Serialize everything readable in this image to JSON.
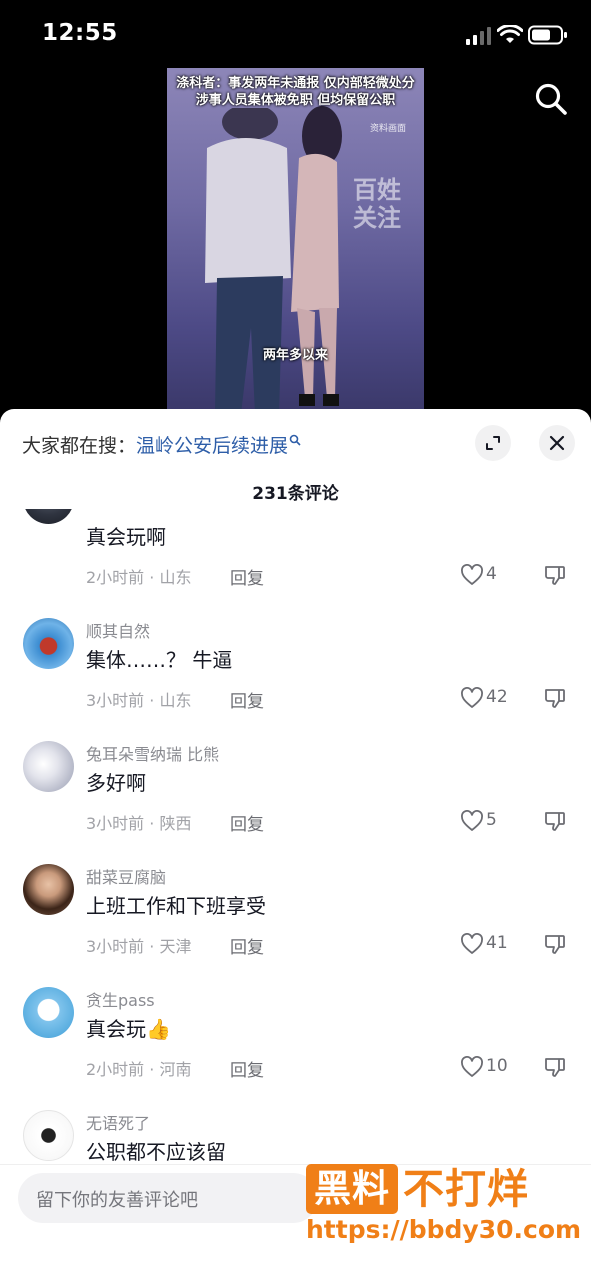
{
  "status_bar": {
    "time": "12:55"
  },
  "video": {
    "caption_line1": "涤科者：事发两年未通报 仅内部轻微处分",
    "caption_line2": "涉事人员集体被免职 但均保留公职",
    "source_tag": "资料画面",
    "watermark": "百姓关注",
    "subtitle": "两年多以来"
  },
  "sheet": {
    "trending_label": "大家都在搜：",
    "trending_term": "温岭公安后续进展",
    "comment_count": "231条评论"
  },
  "comments": [
    {
      "username": "",
      "content": "真会玩啊",
      "meta": "2小时前 · 山东",
      "reply": "回复",
      "likes": "4"
    },
    {
      "username": "顺其自然",
      "content": "集体……？ 牛逼",
      "meta": "3小时前 · 山东",
      "reply": "回复",
      "likes": "42"
    },
    {
      "username": "兔耳朵雪纳瑞 比熊",
      "content": "多好啊",
      "meta": "3小时前 · 陕西",
      "reply": "回复",
      "likes": "5"
    },
    {
      "username": "甜菜豆腐脑",
      "content": "上班工作和下班享受",
      "meta": "3小时前 · 天津",
      "reply": "回复",
      "likes": "41"
    },
    {
      "username": "贪生pass",
      "content": "真会玩👍",
      "meta": "2小时前 · 河南",
      "reply": "回复",
      "likes": "10"
    },
    {
      "username": "无语死了",
      "content": "公职都不应该留",
      "meta": "",
      "reply": "",
      "likes": ""
    }
  ],
  "input": {
    "placeholder": "留下你的友善评论吧"
  },
  "brand_overlay": {
    "badge": "黑料",
    "text": "不打烊",
    "url": "https://bbdy30.com"
  },
  "colors": {
    "accent": "#f07f17",
    "link": "#2e5ea8"
  },
  "icons": [
    "search-icon",
    "expand-icon",
    "close-icon",
    "heart-icon",
    "dislike-icon",
    "wifi-icon",
    "battery-icon",
    "signal-icon"
  ]
}
